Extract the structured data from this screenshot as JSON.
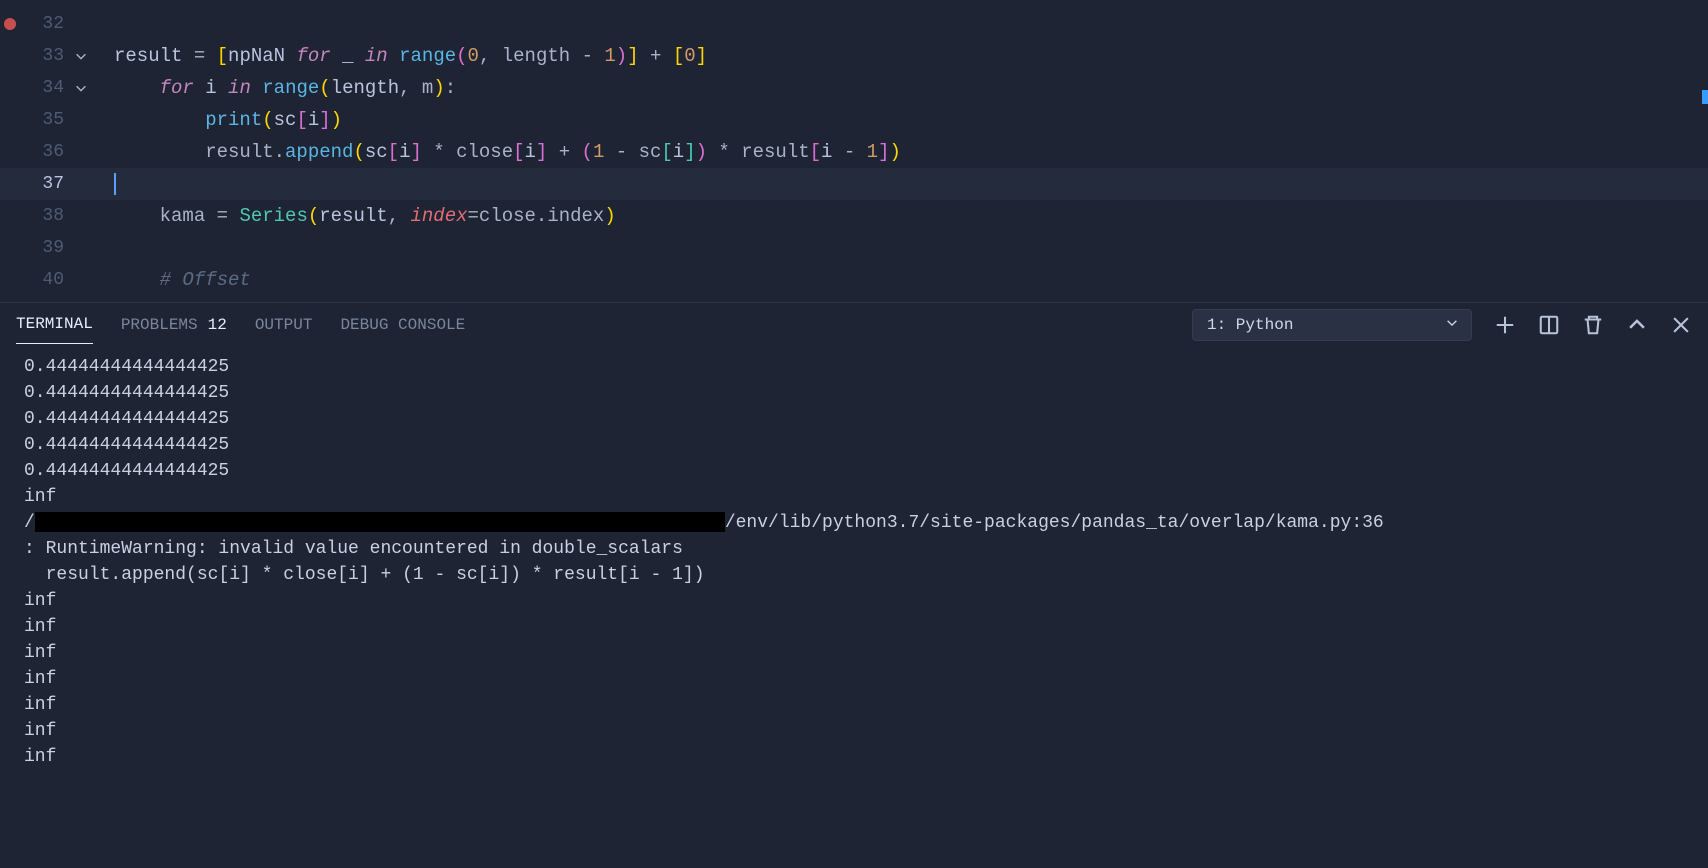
{
  "editor": {
    "breakpoint_line": 32,
    "current_line": 37,
    "lines": [
      {
        "num": 32,
        "fold": "",
        "tokens": []
      },
      {
        "num": 33,
        "fold": "v",
        "tokens": [
          {
            "c": "tk-var",
            "t": "result "
          },
          {
            "c": "tk-op",
            "t": "= "
          },
          {
            "c": "tk-bracket1",
            "t": "["
          },
          {
            "c": "tk-var",
            "t": "npNaN "
          },
          {
            "c": "tk-kw",
            "t": "for"
          },
          {
            "c": "tk-var",
            "t": " _ "
          },
          {
            "c": "tk-kw",
            "t": "in"
          },
          {
            "c": "tk-var",
            "t": " "
          },
          {
            "c": "tk-func",
            "t": "range"
          },
          {
            "c": "tk-bracket2",
            "t": "("
          },
          {
            "c": "tk-num",
            "t": "0"
          },
          {
            "c": "tk-op",
            "t": ", length "
          },
          {
            "c": "tk-op",
            "t": "- "
          },
          {
            "c": "tk-num",
            "t": "1"
          },
          {
            "c": "tk-bracket2",
            "t": ")"
          },
          {
            "c": "tk-bracket1",
            "t": "]"
          },
          {
            "c": "tk-op",
            "t": " + "
          },
          {
            "c": "tk-bracket1",
            "t": "["
          },
          {
            "c": "tk-num",
            "t": "0"
          },
          {
            "c": "tk-bracket1",
            "t": "]"
          }
        ]
      },
      {
        "num": 34,
        "fold": "v",
        "tokens": [
          {
            "c": "tk-op",
            "t": "    "
          },
          {
            "c": "tk-kw",
            "t": "for"
          },
          {
            "c": "tk-var",
            "t": " i "
          },
          {
            "c": "tk-kw",
            "t": "in"
          },
          {
            "c": "tk-var",
            "t": " "
          },
          {
            "c": "tk-func",
            "t": "range"
          },
          {
            "c": "tk-bracket1",
            "t": "("
          },
          {
            "c": "tk-var",
            "t": "length"
          },
          {
            "c": "tk-op",
            "t": ", m"
          },
          {
            "c": "tk-bracket1",
            "t": ")"
          },
          {
            "c": "tk-op",
            "t": ":"
          }
        ]
      },
      {
        "num": 35,
        "fold": "",
        "tokens": [
          {
            "c": "tk-op",
            "t": "        "
          },
          {
            "c": "tk-func",
            "t": "print"
          },
          {
            "c": "tk-bracket1",
            "t": "("
          },
          {
            "c": "tk-var",
            "t": "sc"
          },
          {
            "c": "tk-bracket2",
            "t": "["
          },
          {
            "c": "tk-var",
            "t": "i"
          },
          {
            "c": "tk-bracket2",
            "t": "]"
          },
          {
            "c": "tk-bracket1",
            "t": ")"
          }
        ]
      },
      {
        "num": 36,
        "fold": "",
        "tokens": [
          {
            "c": "tk-op",
            "t": "        result."
          },
          {
            "c": "tk-func",
            "t": "append"
          },
          {
            "c": "tk-bracket1",
            "t": "("
          },
          {
            "c": "tk-var",
            "t": "sc"
          },
          {
            "c": "tk-bracket2",
            "t": "["
          },
          {
            "c": "tk-var",
            "t": "i"
          },
          {
            "c": "tk-bracket2",
            "t": "]"
          },
          {
            "c": "tk-op",
            "t": " * close"
          },
          {
            "c": "tk-bracket2",
            "t": "["
          },
          {
            "c": "tk-var",
            "t": "i"
          },
          {
            "c": "tk-bracket2",
            "t": "]"
          },
          {
            "c": "tk-op",
            "t": " + "
          },
          {
            "c": "tk-bracket2",
            "t": "("
          },
          {
            "c": "tk-num",
            "t": "1"
          },
          {
            "c": "tk-op",
            "t": " - sc"
          },
          {
            "c": "tk-bracket3",
            "t": "["
          },
          {
            "c": "tk-var",
            "t": "i"
          },
          {
            "c": "tk-bracket3",
            "t": "]"
          },
          {
            "c": "tk-bracket2",
            "t": ")"
          },
          {
            "c": "tk-op",
            "t": " * result"
          },
          {
            "c": "tk-bracket2",
            "t": "["
          },
          {
            "c": "tk-var",
            "t": "i "
          },
          {
            "c": "tk-op",
            "t": "- "
          },
          {
            "c": "tk-num",
            "t": "1"
          },
          {
            "c": "tk-bracket2",
            "t": "]"
          },
          {
            "c": "tk-bracket1",
            "t": ")"
          }
        ]
      },
      {
        "num": 37,
        "fold": "",
        "tokens": []
      },
      {
        "num": 38,
        "fold": "",
        "tokens": [
          {
            "c": "tk-op",
            "t": "    kama "
          },
          {
            "c": "tk-op",
            "t": "= "
          },
          {
            "c": "tk-class",
            "t": "Series"
          },
          {
            "c": "tk-bracket1",
            "t": "("
          },
          {
            "c": "tk-var",
            "t": "result"
          },
          {
            "c": "tk-op",
            "t": ", "
          },
          {
            "c": "tk-param",
            "t": "index"
          },
          {
            "c": "tk-op",
            "t": "=close.index"
          },
          {
            "c": "tk-bracket1",
            "t": ")"
          }
        ]
      },
      {
        "num": 39,
        "fold": "",
        "tokens": []
      },
      {
        "num": 40,
        "fold": "",
        "tokens": [
          {
            "c": "tk-op",
            "t": "    "
          },
          {
            "c": "tk-comment",
            "t": "# Offset"
          }
        ]
      }
    ]
  },
  "panel": {
    "tabs": {
      "terminal": "TERMINAL",
      "problems": "PROBLEMS",
      "problems_count": "12",
      "output": "OUTPUT",
      "debug": "DEBUG CONSOLE"
    },
    "select_label": "1: Python"
  },
  "terminal": {
    "lines": [
      "0.44444444444444425",
      "0.44444444444444425",
      "0.44444444444444425",
      "0.44444444444444425",
      "0.44444444444444425",
      "inf"
    ],
    "path_suffix": "/env/lib/python3.7/site-packages/pandas_ta/overlap/kama.py:36",
    "warning_line1": ": RuntimeWarning: invalid value encountered in double_scalars",
    "warning_line2": "  result.append(sc[i] * close[i] + (1 - sc[i]) * result[i - 1])",
    "tail_lines": [
      "inf",
      "inf",
      "inf",
      "inf",
      "inf",
      "inf",
      "inf"
    ]
  }
}
